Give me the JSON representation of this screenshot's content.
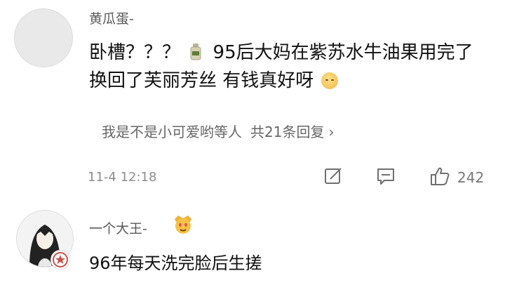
{
  "comment1": {
    "username": "黄瓜蛋-",
    "text_part1": "卧槽？？？",
    "text_part2": "95后大妈在紫苏水牛油果用完了换回了芙丽芳丝 有钱真好呀",
    "inline_icon": "bottle-icon",
    "end_emoji": "face-emoji"
  },
  "replies": {
    "label": "我是不是小可爱哟等人",
    "count_text": "共21条回复",
    "chevron": "›"
  },
  "meta": {
    "timestamp": "11-4 12:18",
    "like_count": "242",
    "icons": [
      "share-icon",
      "comment-icon",
      "like-icon"
    ]
  },
  "comment2": {
    "username": "一个大王-",
    "badge_emoji": "heart-eyes-crown-emoji",
    "text": "96年每天洗完脸后生搓"
  }
}
